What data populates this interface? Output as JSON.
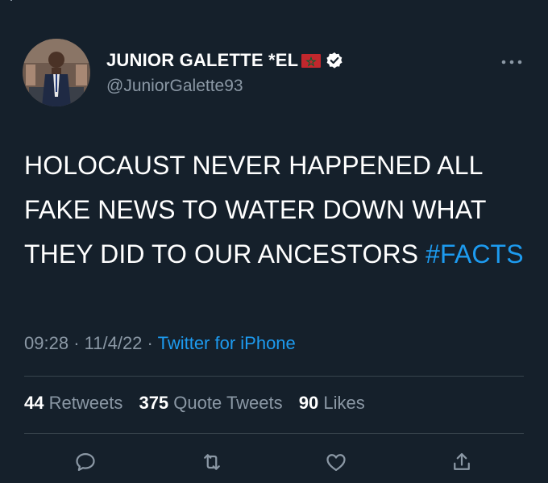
{
  "author": {
    "display_name": "JUNIOR GALETTE *EL",
    "handle": "@JuniorGalette93",
    "flag_icon": "morocco-flag-icon",
    "verified_icon": "verified-badge-icon"
  },
  "tweet": {
    "text_main": "HOLOCAUST NEVER HAPPENED ALL FAKE NEWS TO WATER DOWN WHAT THEY DID TO OUR ANCESTORS ",
    "hashtag": "#FACTS",
    "time": "09:28",
    "separator": "·",
    "date": "11/4/22",
    "source": "Twitter for iPhone"
  },
  "stats": {
    "retweets_count": "44",
    "retweets_label": "Retweets",
    "quotes_count": "375",
    "quotes_label": "Quote Tweets",
    "likes_count": "90",
    "likes_label": "Likes"
  },
  "actions": [
    "reply-icon",
    "retweet-icon",
    "like-icon",
    "share-icon"
  ],
  "colors": {
    "background": "#15202b",
    "text": "#ffffff",
    "secondary": "#8b98a5",
    "accent": "#1d9bf0",
    "divider": "#38444d"
  }
}
